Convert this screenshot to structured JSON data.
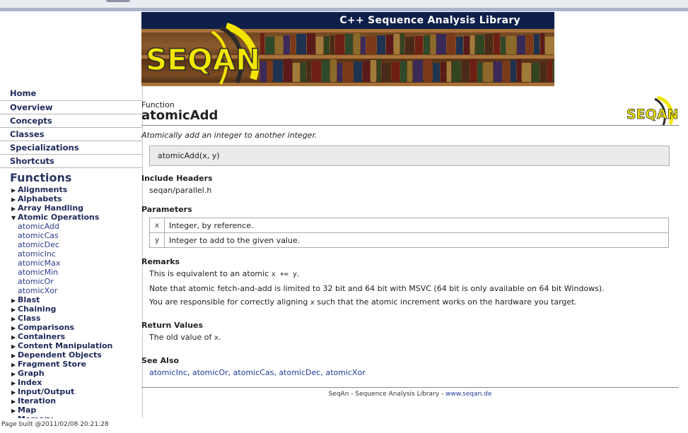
{
  "banner": {
    "title": "C++ Sequence Analysis Library",
    "logo_text": "SEQAN"
  },
  "sidebar": {
    "links": [
      "Home",
      "Overview",
      "Concepts",
      "Classes",
      "Specializations",
      "Shortcuts"
    ],
    "heading": "Functions",
    "tree": [
      {
        "label": "Alignments",
        "expanded": false
      },
      {
        "label": "Alphabets",
        "expanded": false
      },
      {
        "label": "Array Handling",
        "expanded": false
      },
      {
        "label": "Atomic Operations",
        "expanded": true,
        "children": [
          "atomicAdd",
          "atomicCas",
          "atomicDec",
          "atomicInc",
          "atomicMax",
          "atomicMin",
          "atomicOr",
          "atomicXor"
        ]
      },
      {
        "label": "Blast",
        "expanded": false
      },
      {
        "label": "Chaining",
        "expanded": false
      },
      {
        "label": "Class",
        "expanded": false
      },
      {
        "label": "Comparisons",
        "expanded": false
      },
      {
        "label": "Containers",
        "expanded": false
      },
      {
        "label": "Content Manipulation",
        "expanded": false
      },
      {
        "label": "Dependent Objects",
        "expanded": false
      },
      {
        "label": "Fragment Store",
        "expanded": false
      },
      {
        "label": "Graph",
        "expanded": false
      },
      {
        "label": "Index",
        "expanded": false
      },
      {
        "label": "Input/Output",
        "expanded": false
      },
      {
        "label": "Iteration",
        "expanded": false
      },
      {
        "label": "Map",
        "expanded": false
      },
      {
        "label": "Memory",
        "expanded": false
      }
    ]
  },
  "page_built": "Page built @2011/02/08 20:21:28",
  "main": {
    "kind": "Function",
    "name": "atomicAdd",
    "logo_text": "SEQAN",
    "description": "Atomically add an integer to another integer.",
    "signature": "atomicAdd(x, y)",
    "include_heading": "Include Headers",
    "include_file": "seqan/parallel.h",
    "params_heading": "Parameters",
    "params": [
      {
        "name": "x",
        "desc": "Integer, by reference."
      },
      {
        "name": "y",
        "desc": "Integer to add to the given value."
      }
    ],
    "remarks_heading": "Remarks",
    "remark1_pre": "This is equivalent to an atomic ",
    "remark1_code": "x += y",
    "remark1_post": ".",
    "remark2": "Note that atomic fetch-and-add is limited to 32 bit and 64 bit with MSVC (64 bit is only available on 64 bit Windows).",
    "remark3_pre": "You are responsible for correctly aligning ",
    "remark3_code": "x",
    "remark3_post": " such that the atomic increment works on the hardware you target.",
    "return_heading": "Return Values",
    "return_pre": "The old value of ",
    "return_code": "x",
    "return_post": ".",
    "seealso_heading": "See Also",
    "seealso": [
      "atomicInc",
      "atomicOr",
      "atomicCas",
      "atomicDec",
      "atomicXor"
    ],
    "footer_text": "SeqAn - Sequence Analysis Library - ",
    "footer_link": "www.seqan.de"
  }
}
